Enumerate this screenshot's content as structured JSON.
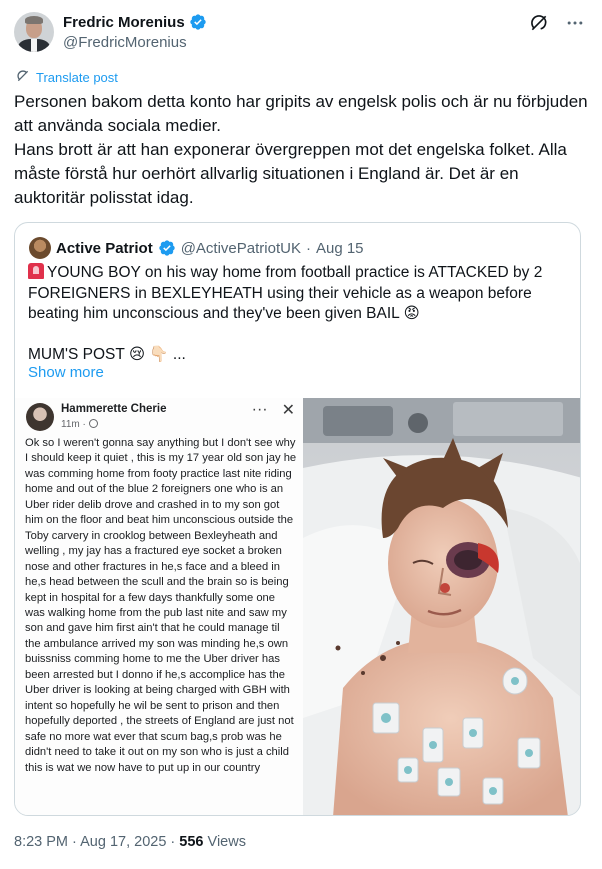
{
  "author": {
    "display_name": "Fredric Morenius",
    "handle": "@FredricMorenius",
    "verified": true,
    "verified_color": "#1d9bf0"
  },
  "icons": {
    "grok": "grok-icon",
    "more": "more-icon",
    "translate": "translate-icon"
  },
  "translate_label": "Translate post",
  "tweet_text": "Personen bakom detta konto har gripits av engelsk polis och är nu förbjuden att använda sociala medier.\nHans brott är att han exponerar övergreppen mot det engelska folket. Alla måste förstå hur oerhört allvarlig situationen i England är. Det är en auktoritär polisstat idag.",
  "quote": {
    "display_name": "Active Patriot",
    "handle": "@ActivePatriotUK",
    "separator": "·",
    "date": "Aug 15",
    "text_line1": "YOUNG BOY on his way home from football practice is ATTACKED by 2 FOREIGNERS in BEXLEYHEATH using their vehicle as a weapon before beating him unconscious and they've been given BAIL 😡",
    "text_line2": "MUM'S POST 😢 👇🏻 ...",
    "show_more": "Show more",
    "embedded_post": {
      "author": "Hammerette Cherie",
      "time": "11m ·",
      "more": "···",
      "close": "✕",
      "body": "Ok so I weren't gonna say anything but I don't see why I should keep it quiet , this is my 17 year old son jay he was comming home from footy practice last nite riding home and out of the blue 2 foreigners one who is an Uber rider delib drove and crashed in to my son got him on the floor and beat him unconscious outside the Toby carvery in crooklog between Bexleyheath and welling , my jay has a fractured eye socket a broken nose and other fractures in he,s face and a bleed in he,s head between the scull and the brain so is being kept in hospital for a few days thankfully some one was walking home from the pub last nite and saw my son and gave him first ain't that he could manage til the ambulance arrived my son was minding he,s own buissniss comming home to me the Uber driver has been arrested but I donno if he,s accomplice has the Uber driver is looking at being charged with GBH with intent so hopefully he wil be sent to prison and then hopefully deported , the streets of England are just not safe no more wat ever that scum bag,s prob was he didn't need to take it out on my son who is just a child this is wat we now have to put up in our country"
    }
  },
  "footer": {
    "time": "8:23 PM",
    "separator": "·",
    "date": "Aug 17, 2025",
    "separator2": "·",
    "views_count": "556",
    "views_label": "Views"
  }
}
